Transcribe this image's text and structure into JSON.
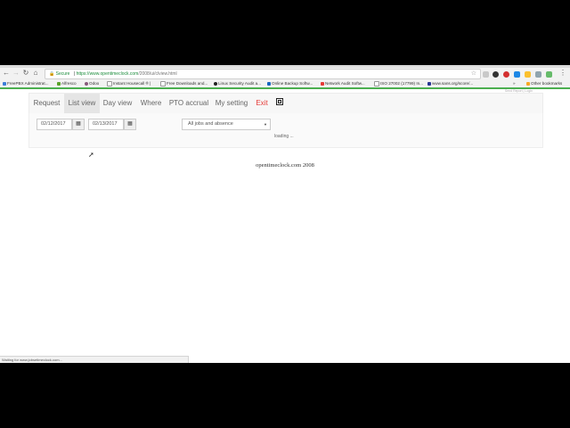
{
  "browser": {
    "secure_label": "Secure",
    "url_host": "https://www.opentimeclock.com",
    "url_path": "/2008/ui/clview.html",
    "bookmarks": [
      {
        "label": "FreePBX Administrat...",
        "color": "#3b7dd8"
      },
      {
        "label": "Alfresco",
        "color": "#5aa32a"
      },
      {
        "label": "Odoo",
        "color": "#875a7b"
      },
      {
        "label": "Instant Housecall ® |",
        "color": "#777777"
      },
      {
        "label": "Free Downloads and...",
        "color": "#777777"
      },
      {
        "label": "Linux Security Audit a...",
        "color": "#222222"
      },
      {
        "label": "Online Backup Softw...",
        "color": "#1565c0"
      },
      {
        "label": "Network Audit Softw...",
        "color": "#e53935"
      },
      {
        "label": "ISO 27002 (17799) In...",
        "color": "#777777"
      },
      {
        "label": "www.sans.org/score/...",
        "color": "#283593"
      },
      {
        "label": "Other bookmarks",
        "color": "#f9a825"
      }
    ],
    "status_text": "Waiting for www.jobsetimeclock.com..."
  },
  "nav": {
    "tabs": [
      {
        "label": "Request"
      },
      {
        "label": "List view"
      },
      {
        "label": "Day view"
      },
      {
        "label": "Where"
      },
      {
        "label": "PTO accrual"
      },
      {
        "label": "My setting"
      },
      {
        "label": "Exit"
      }
    ],
    "top_right_note": "Send Report | Login"
  },
  "filters": {
    "start_date": "02/12/2017",
    "end_date": "02/13/2017",
    "job_select": "All jobs and absence",
    "loading_text": "loading ..."
  },
  "footer": {
    "text": "opentimeclock.com 2008"
  },
  "colors": {
    "exit": "#e53935",
    "secure": "#1e8e3e",
    "bookmark_bar_border": "#4caf50"
  }
}
